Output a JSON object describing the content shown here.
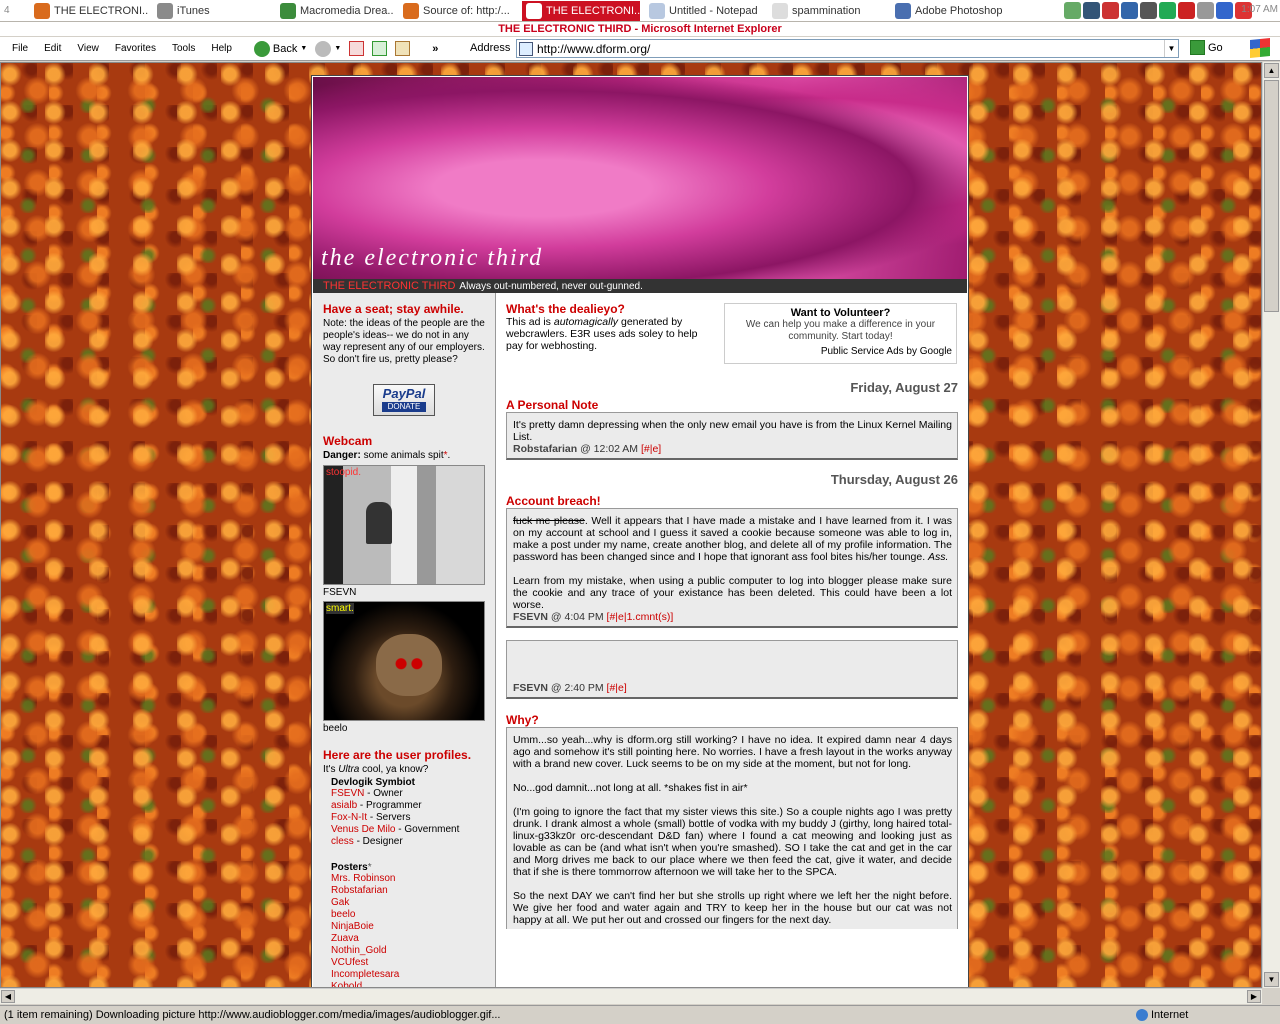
{
  "taskbar": {
    "number": "4",
    "tasks": [
      {
        "label": "THE ELECTRONI...",
        "icon": "firefox-icon",
        "color": "#d96b1d",
        "active": false
      },
      {
        "label": "iTunes",
        "icon": "itunes-icon",
        "color": "#8a8a8a",
        "active": false
      },
      {
        "label": "Macromedia Drea...",
        "icon": "dreamweaver-icon",
        "color": "#3c8c3c",
        "active": false
      },
      {
        "label": "Source of: http:/...",
        "icon": "firefox-icon",
        "color": "#d96b1d",
        "active": false
      },
      {
        "label": "THE ELECTRONI...",
        "icon": "ie-icon",
        "color": "#ffffff",
        "active": true
      },
      {
        "label": "Untitled - Notepad",
        "icon": "notepad-icon",
        "color": "#b8c8e0",
        "active": false
      },
      {
        "label": "spammination",
        "icon": "spam-icon",
        "color": "#dddddd",
        "active": false
      },
      {
        "label": "Adobe Photoshop",
        "icon": "photoshop-icon",
        "color": "#4a6fb0",
        "active": false
      }
    ],
    "clock": "1:07 AM"
  },
  "window": {
    "title": "THE ELECTRONIC THIRD - Microsoft Internet Explorer"
  },
  "menu": [
    "File",
    "Edit",
    "View",
    "Favorites",
    "Tools",
    "Help"
  ],
  "toolbar": {
    "back": "Back",
    "address_label": "Address",
    "go": "Go",
    "url": "http://www.dform.org/"
  },
  "status": {
    "text": "(1 item remaining) Downloading picture http://www.audioblogger.com/media/images/audioblogger.gif...",
    "zone": "Internet"
  },
  "banner": {
    "title": "the electronic third",
    "site_name": "THE ELECTRONIC THIRD",
    "tagline": "Always out-numbered, never out-gunned."
  },
  "sidebar": {
    "heading1": "Have a seat; stay awhile.",
    "note": "Note: the ideas of the people are the people's ideas-- we do not in any way represent any of our employers. So don't fire us, pretty please?",
    "paypal": "PayPal",
    "paypal_donate": "DONATE",
    "webcam_heading": "Webcam",
    "danger_label": "Danger:",
    "danger_text": "some animals spit",
    "cam1_label": "stoopid.",
    "cam1_caption": "FSEVN",
    "cam2_label": "smart.",
    "cam2_caption": "beelo",
    "profiles_heading": "Here are the user profiles.",
    "profiles_intro_1": "It's ",
    "profiles_intro_em": "Ultra",
    "profiles_intro_2": " cool, ya know?",
    "group1": "Devlogik Symbiot",
    "members": [
      {
        "name": "FSEVN",
        "role": " - Owner"
      },
      {
        "name": "asialb",
        "role": " - Programmer"
      },
      {
        "name": "Fox-N-It",
        "role": " - Servers"
      },
      {
        "name": "Venus De Milo",
        "role": " - Government"
      },
      {
        "name": "cless",
        "role": " - Designer"
      }
    ],
    "group2": "Posters",
    "posters": [
      "Mrs. Robinson",
      "Robstafarian",
      "Gak",
      "beelo",
      "NinjaBoie",
      "Zuava",
      "Nothin_Gold",
      "VCUfest",
      "Incompletesara",
      "Kobold"
    ]
  },
  "ad": {
    "intro_title": "What's the dealieyo?",
    "intro_1": "This ad is ",
    "intro_em": "automagically",
    "intro_2": " generated by webcrawlers. E3R uses ads soley to help pay for webhosting.",
    "title": "Want to Volunteer?",
    "body": "We can help you make a difference in your community. Start today!",
    "footer": "Public Service Ads by Google"
  },
  "posts": {
    "date1": "Friday, August 27",
    "p1_title": "A Personal Note",
    "p1_body": "It's pretty damn depressing when the only new email you have is from the Linux Kernel Mailing List.",
    "p1_author": "Robstafarian",
    "p1_time": " @ 12:02 AM ",
    "p1_links": "[#|e]",
    "date2": "Thursday, August 26",
    "p2_title": "Account breach!",
    "p2_strike": "fuck me please",
    "p2_body1": ". Well it appears that I have made a mistake and I have learned from it. I was on my account at school and I guess it saved a cookie because someone was able to log in, make a post under my name, create another blog, and delete all of my profile information. The password has been changed since and I hope that ignorant ass fool bites his/her tounge. ",
    "p2_em": "Ass.",
    "p2_body2": "Learn from my mistake, when using a public computer to log into blogger please make sure the cookie and any trace of your existance has been deleted. This could have been a lot worse.",
    "p2_author": "FSEVN",
    "p2_time": " @ 4:04 PM ",
    "p2_links": "[#|e|1.cmnt(s)]",
    "p3_author": "FSEVN",
    "p3_time": " @ 2:40 PM ",
    "p3_links": "[#|e]",
    "p4_title": "Why?",
    "p4_para1": "Umm...so yeah...why is dform.org still working? I have no idea. It expired damn near 4 days ago and somehow it's still pointing here. No worries. I have a fresh layout in the works anyway with a brand new cover. Luck seems to be on my side at the moment, but not for long.",
    "p4_para2": "No...god damnit...not long at all. *shakes fist in air*",
    "p4_para3": "(I'm going to ignore the fact that my sister views this site.) So a couple nights ago I was pretty drunk. I drank almost a whole (small) bottle of vodka with my buddy J (girthy, long haired total-linux-g33kz0r orc-descendant D&D fan) where I found a cat meowing and looking just as lovable as can be (and what isn't when you're smashed). SO I take the cat and get in the car and Morg drives me back to our place where we then feed the cat, give it water, and decide that if she is there tommorrow afternoon we will take her to the SPCA.",
    "p4_para4": "So the next DAY we can't find her but she strolls up right where we left her the night before. We give her food and water again and TRY to keep her in the house but our cat was not happy at all. We put her out and crossed our fingers for the next day."
  }
}
